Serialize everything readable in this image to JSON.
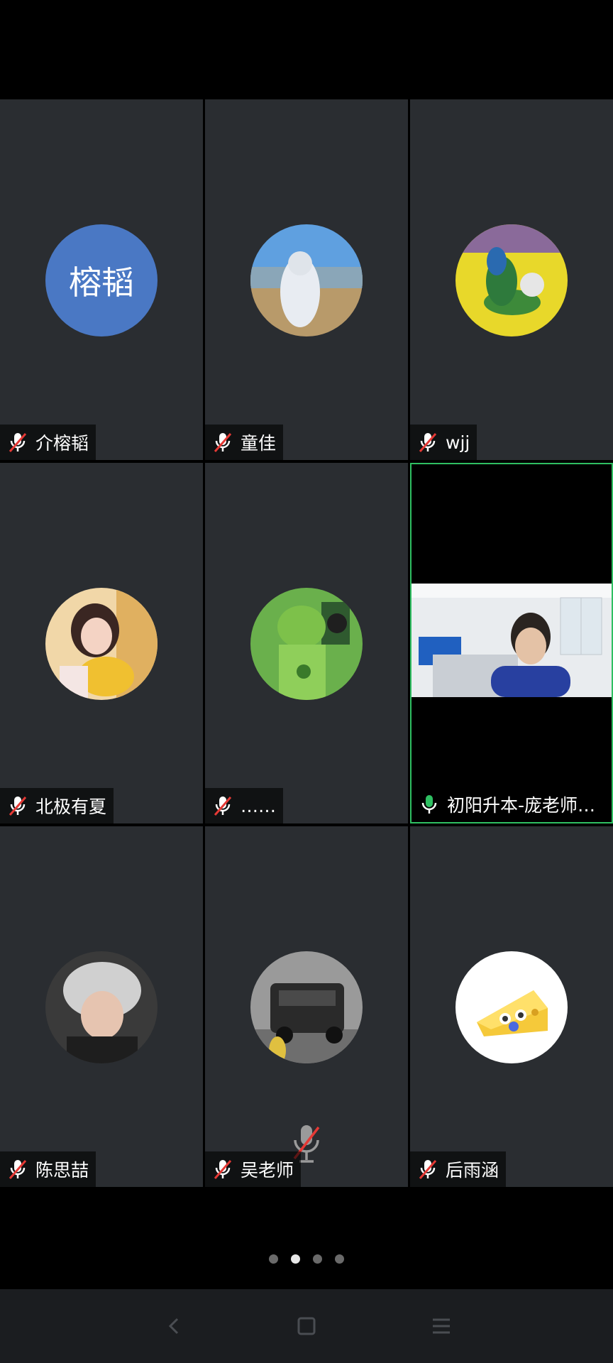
{
  "participants": [
    {
      "name": "介榕韬",
      "avatar_text": "榕韬",
      "avatar_color": "#4a78c4",
      "mic": "muted"
    },
    {
      "name": "童佳",
      "avatar_image": "person-in-white-hoodie-landscape",
      "mic": "muted"
    },
    {
      "name": "wjj",
      "avatar_image": "toy-figure-on-yellow",
      "mic": "muted"
    },
    {
      "name": "北极有夏",
      "avatar_image": "girl-with-bread",
      "mic": "muted"
    },
    {
      "name": "……",
      "avatar_image": "green-hair-figure",
      "mic": "muted"
    },
    {
      "name": "初阳升本-庞老师…",
      "video": "classroom-teacher-video",
      "mic": "active",
      "highlight_color": "#2fbf62"
    },
    {
      "name": "陈思喆",
      "avatar_image": "boy-selfie-helmet",
      "mic": "muted"
    },
    {
      "name": "吴老师",
      "avatar_image": "black-suv-car",
      "mic": "muted",
      "center_icon": "mic-muted-icon"
    },
    {
      "name": "后雨涵",
      "avatar_image": "cheese-emoji",
      "mic": "muted"
    }
  ],
  "pager": {
    "count": 4,
    "active_index": 1
  },
  "nav": [
    "back",
    "home",
    "menu"
  ],
  "colors": {
    "tile_bg": "#2a2d31",
    "muted_red": "#e53935",
    "active_green": "#2fbf62"
  }
}
